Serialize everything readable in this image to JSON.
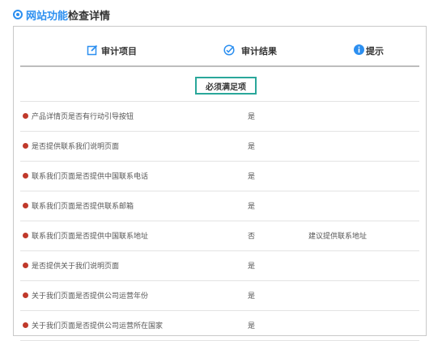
{
  "title": {
    "accent": "网站功能",
    "rest": "检查详情"
  },
  "header": {
    "col_item": "审计项目",
    "col_result": "审计结果",
    "col_tip": "提示"
  },
  "section_label": "必须满足项",
  "rows": [
    {
      "item": "产品详情页是否有行动引导按钮",
      "result": "是",
      "tip": ""
    },
    {
      "item": "是否提供联系我们说明页面",
      "result": "是",
      "tip": ""
    },
    {
      "item": "联系我们页面是否提供中国联系电话",
      "result": "是",
      "tip": ""
    },
    {
      "item": "联系我们页面是否提供联系邮箱",
      "result": "是",
      "tip": ""
    },
    {
      "item": "联系我们页面是否提供中国联系地址",
      "result": "否",
      "tip": "建议提供联系地址"
    },
    {
      "item": "是否提供关于我们说明页面",
      "result": "是",
      "tip": ""
    },
    {
      "item": "关于我们页面是否提供公司运营年份",
      "result": "是",
      "tip": ""
    },
    {
      "item": "关于我们页面是否提供公司运营所在国家",
      "result": "是",
      "tip": ""
    }
  ],
  "colors": {
    "accent": "#2c8ff0",
    "status_dot": "#c0392b",
    "section_border": "#2aa79a"
  },
  "icons": {
    "item": "edit-icon",
    "result": "check-circle-icon",
    "tip": "info-icon",
    "title": "location-icon"
  }
}
